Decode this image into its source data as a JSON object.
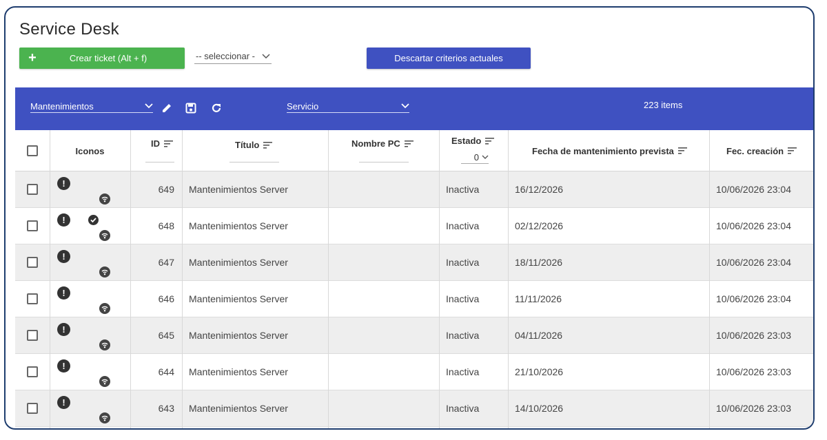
{
  "header": {
    "title": "Service Desk",
    "create_button": "Crear ticket (Alt + f)",
    "select_placeholder": "-- seleccionar -",
    "discard_button": "Descartar criterios actuales"
  },
  "toolbar": {
    "view_select": "Mantenimientos",
    "service_select": "Servicio",
    "items_count": "223 items"
  },
  "columns": {
    "icons": "Iconos",
    "id": "ID",
    "title": "Título",
    "pc_name": "Nombre PC",
    "status": "Estado",
    "status_filter": "0",
    "maint_date": "Fecha de mantenimiento prevista",
    "created": "Fec. creación"
  },
  "rows": [
    {
      "id": "649",
      "title": "Mantenimientos Server",
      "pc": "",
      "status": "Inactiva",
      "maint_date": "16/12/2026",
      "created": "10/06/2026 23:04",
      "checked_icon": false
    },
    {
      "id": "648",
      "title": "Mantenimientos Server",
      "pc": "",
      "status": "Inactiva",
      "maint_date": "02/12/2026",
      "created": "10/06/2026 23:04",
      "checked_icon": true
    },
    {
      "id": "647",
      "title": "Mantenimientos Server",
      "pc": "",
      "status": "Inactiva",
      "maint_date": "18/11/2026",
      "created": "10/06/2026 23:04",
      "checked_icon": false
    },
    {
      "id": "646",
      "title": "Mantenimientos Server",
      "pc": "",
      "status": "Inactiva",
      "maint_date": "11/11/2026",
      "created": "10/06/2026 23:04",
      "checked_icon": false
    },
    {
      "id": "645",
      "title": "Mantenimientos Server",
      "pc": "",
      "status": "Inactiva",
      "maint_date": "04/11/2026",
      "created": "10/06/2026 23:03",
      "checked_icon": false
    },
    {
      "id": "644",
      "title": "Mantenimientos Server",
      "pc": "",
      "status": "Inactiva",
      "maint_date": "21/10/2026",
      "created": "10/06/2026 23:03",
      "checked_icon": false
    },
    {
      "id": "643",
      "title": "Mantenimientos Server",
      "pc": "",
      "status": "Inactiva",
      "maint_date": "14/10/2026",
      "created": "10/06/2026 23:03",
      "checked_icon": false
    }
  ],
  "colors": {
    "accent": "#3f51c1",
    "create": "#4bb34f",
    "row_alt": "#eeeeee"
  },
  "icons": [
    "plus-icon",
    "chevron-down-icon",
    "edit-icon",
    "save-icon",
    "refresh-icon",
    "sort-icon",
    "alert-icon",
    "check-icon",
    "wifi-icon"
  ]
}
